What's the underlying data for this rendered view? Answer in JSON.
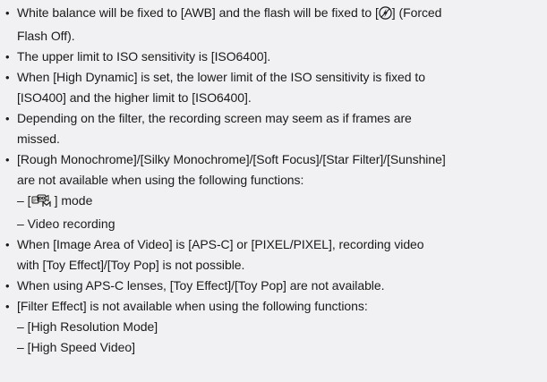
{
  "notes": {
    "bullet": "•",
    "items": {
      "wb_flash_prefix": "White balance will be fixed to [AWB] and the flash will be fixed to [",
      "wb_flash_suffix": "] (Forced",
      "wb_flash_line2": "Flash Off).",
      "iso_upper": "The upper limit to ISO sensitivity is [ISO6400].",
      "high_dynamic_1": "When [High Dynamic] is set, the lower limit of the ISO sensitivity is fixed to",
      "high_dynamic_2": "[ISO400] and the higher limit to [ISO6400].",
      "filter_frames_1": "Depending on the filter, the recording screen may seem as if frames are",
      "filter_frames_2": "missed.",
      "rough_mono_1": "[Rough Monochrome]/[Silky Monochrome]/[Soft Focus]/[Star Filter]/[Sunshine]",
      "rough_mono_2": "are not available when using the following functions:",
      "sub_mode_prefix": "– [",
      "sub_mode_suffix": "] mode",
      "sub_video": "– Video recording",
      "image_area_1": "When [Image Area of Video] is [APS-C] or [PIXEL/PIXEL], recording video",
      "image_area_2": "with [Toy Effect]/[Toy Pop] is not possible.",
      "apsc_lenses": "When using APS-C lenses, [Toy Effect]/[Toy Pop] are not available.",
      "filter_effect": "[Filter Effect] is not available when using the following functions:",
      "sub_high_res": "– [High Resolution Mode]",
      "sub_high_speed": "– [High Speed Video]"
    },
    "icons": {
      "flash": "flash-off-icon",
      "creative_video": "creative-video-mode-icon"
    }
  }
}
